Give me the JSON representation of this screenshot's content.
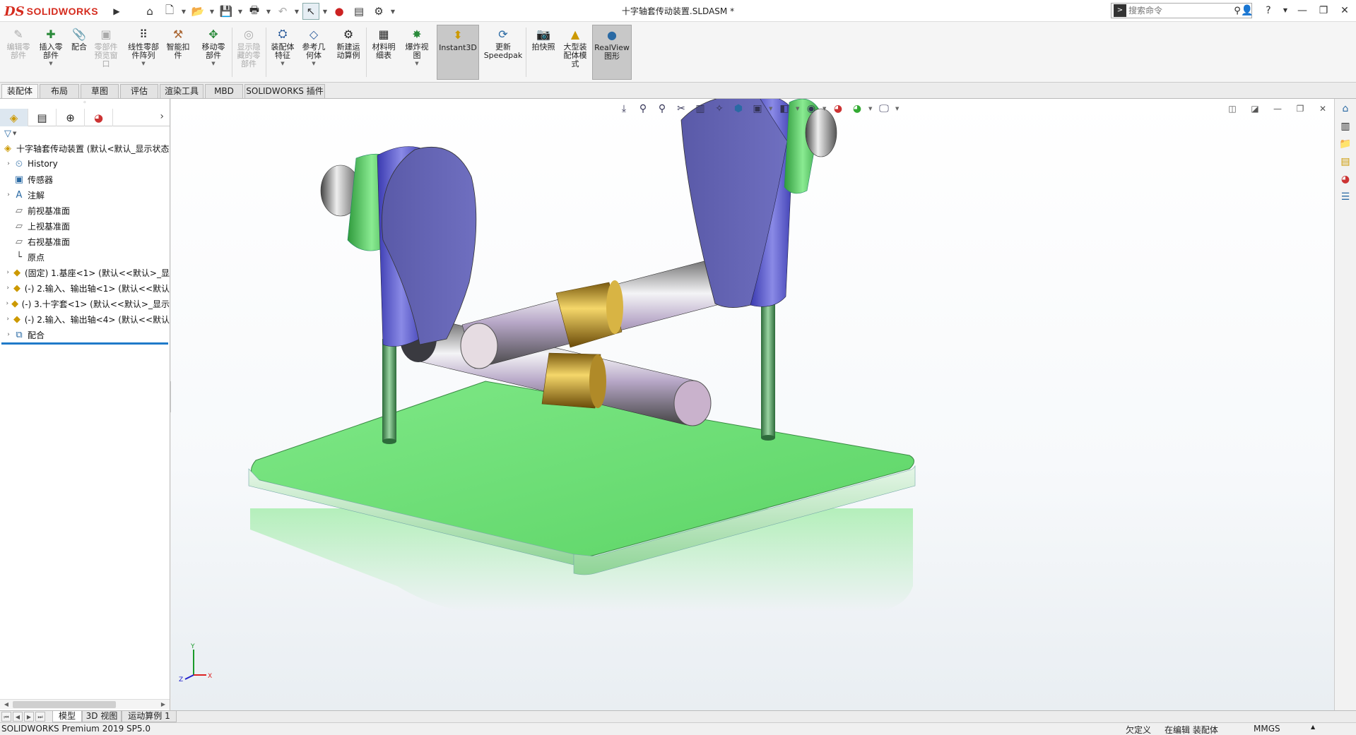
{
  "app": {
    "brand_ds": "DS",
    "brand_name": "SOLIDWORKS"
  },
  "title": "十字轴套传动装置.SLDASM *",
  "search": {
    "placeholder": "搜索命令"
  },
  "ribbon": {
    "buttons": [
      {
        "label": "编辑零\n部件",
        "icon": "edit-component-icon"
      },
      {
        "label": "插入零\n部件",
        "icon": "insert-component-icon"
      },
      {
        "label": "配合",
        "icon": "mate-icon"
      },
      {
        "label": "零部件\n预览窗\n口",
        "icon": "component-preview-icon"
      },
      {
        "label": "线性零部\n件阵列",
        "icon": "linear-pattern-icon"
      },
      {
        "label": "智能扣\n件",
        "icon": "smart-fasteners-icon"
      },
      {
        "label": "移动零\n部件",
        "icon": "move-component-icon"
      },
      {
        "label": "显示隐\n藏的零\n部件",
        "icon": "show-hidden-icon"
      },
      {
        "label": "装配体\n特征",
        "icon": "assembly-features-icon"
      },
      {
        "label": "参考几\n何体",
        "icon": "reference-geometry-icon"
      },
      {
        "label": "新建运\n动算例",
        "icon": "new-motion-study-icon"
      },
      {
        "label": "材料明\n细表",
        "icon": "bom-icon"
      },
      {
        "label": "爆炸视\n图",
        "icon": "exploded-view-icon"
      },
      {
        "label": "Instant3D",
        "icon": "instant3d-icon"
      },
      {
        "label": "更新\nSpeedpak",
        "icon": "speedpak-icon"
      },
      {
        "label": "拍快照",
        "icon": "snapshot-icon"
      },
      {
        "label": "大型装\n配体模\n式",
        "icon": "large-assembly-icon"
      },
      {
        "label": "RealView\n图形",
        "icon": "realview-icon"
      }
    ]
  },
  "cm_tabs": [
    "装配体",
    "布局",
    "草图",
    "评估",
    "渲染工具",
    "MBD",
    "SOLIDWORKS 插件"
  ],
  "tree": {
    "root": "十字轴套传动装置  (默认<默认_显示状态",
    "items": [
      {
        "label": "History",
        "icon": "history-icon",
        "expandable": true
      },
      {
        "label": "传感器",
        "icon": "sensor-icon",
        "expandable": false
      },
      {
        "label": "注解",
        "icon": "annotation-icon",
        "expandable": true
      },
      {
        "label": "前视基准面",
        "icon": "plane-icon",
        "expandable": false
      },
      {
        "label": "上视基准面",
        "icon": "plane-icon",
        "expandable": false
      },
      {
        "label": "右视基准面",
        "icon": "plane-icon",
        "expandable": false
      },
      {
        "label": "原点",
        "icon": "origin-icon",
        "expandable": false
      },
      {
        "label": "(固定) 1.基座<1> (默认<<默认>_显",
        "icon": "part-icon",
        "expandable": true
      },
      {
        "label": "(-) 2.输入、输出轴<1> (默认<<默认",
        "icon": "part-icon",
        "expandable": true
      },
      {
        "label": "(-) 3.十字套<1> (默认<<默认>_显示",
        "icon": "part-icon",
        "expandable": true
      },
      {
        "label": "(-) 2.输入、输出轴<4> (默认<<默认",
        "icon": "part-icon",
        "expandable": true
      },
      {
        "label": "配合",
        "icon": "mates-folder-icon",
        "expandable": true
      }
    ]
  },
  "bottom_tabs": [
    "模型",
    "3D 视图",
    "运动算例 1"
  ],
  "status": {
    "app_version": "SOLIDWORKS Premium 2019 SP5.0",
    "definition": "欠定义",
    "editing": "在编辑 装配体",
    "units": "MMGS"
  },
  "triad": {
    "x": "X",
    "y": "Y",
    "z": "Z"
  },
  "colors": {
    "brand_red": "#d52b1e",
    "base_green": "#6fdc78",
    "arm_purple": "#6666bb",
    "collar_green": "#4fc85a",
    "bushing_gold": "#c8a030",
    "shaft_steel": "#9a9aa2"
  }
}
